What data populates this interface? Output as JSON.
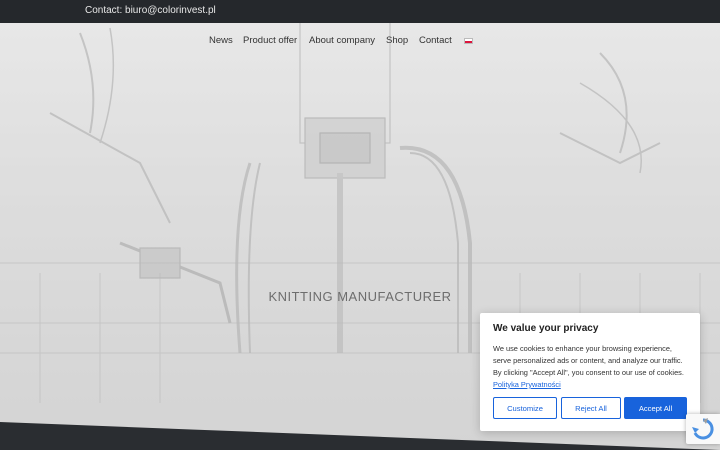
{
  "topbar": {
    "contact": "Contact: biuro@colorinvest.pl"
  },
  "nav": {
    "items": [
      "News",
      "Product offer",
      "About company",
      "Shop",
      "Contact"
    ],
    "language_flag_icon": "poland-flag-icon"
  },
  "hero": {
    "headline": "KNITTING MANUFACTURER"
  },
  "cookie": {
    "title": "We value your privacy",
    "body": "We use cookies to enhance your browsing experience, serve personalized ads or content, and analyze our traffic. By clicking \"Accept All\", you consent to our use of cookies.",
    "policy_link": "Polityka Prywatności",
    "customize_label": "Customize",
    "reject_label": "Reject All",
    "accept_label": "Accept All"
  },
  "colors": {
    "accent": "#1863dc",
    "topbar": "#25282c",
    "footer": "#2a2d31"
  },
  "recaptcha_icon": "recaptcha-icon"
}
